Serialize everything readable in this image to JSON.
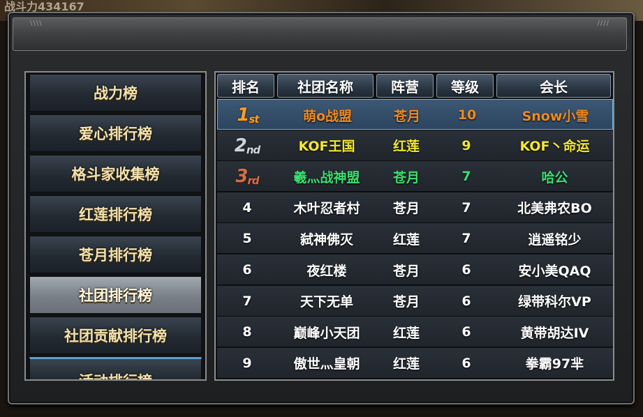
{
  "topbar": {
    "text": "战斗力434167"
  },
  "menu": {
    "items": [
      {
        "label": "战力榜"
      },
      {
        "label": "爱心排行榜"
      },
      {
        "label": "格斗家收集榜"
      },
      {
        "label": "红莲排行榜"
      },
      {
        "label": "苍月排行榜"
      },
      {
        "label": "社团排行榜",
        "selected": true
      },
      {
        "label": "社团贡献排行榜"
      },
      {
        "label": "活动排行榜"
      }
    ]
  },
  "table": {
    "headers": {
      "rank": "排名",
      "name": "社团名称",
      "faction": "阵营",
      "level": "等级",
      "leader": "会长"
    },
    "badges": {
      "first": {
        "num": "1",
        "suffix": "st"
      },
      "second": {
        "num": "2",
        "suffix": "nd"
      },
      "third": {
        "num": "3",
        "suffix": "rd"
      }
    },
    "rows": [
      {
        "rank": "1st",
        "name": "萌o战盟",
        "faction": "苍月",
        "level": "10",
        "leader": "Snow小雪",
        "color": "#f08a20"
      },
      {
        "rank": "2nd",
        "name": "KOF王国",
        "faction": "红莲",
        "level": "9",
        "leader": "KOF丶命运",
        "color": "#f2e832"
      },
      {
        "rank": "3rd",
        "name": "羲灬战神盟",
        "faction": "苍月",
        "level": "7",
        "leader": "哈公",
        "color": "#3ae070"
      },
      {
        "rank": "4",
        "name": "木叶忍者村",
        "faction": "苍月",
        "level": "7",
        "leader": "北美弗农BO",
        "color": "#ffffff"
      },
      {
        "rank": "5",
        "name": "弑神佛灭",
        "faction": "红莲",
        "level": "7",
        "leader": "逍遥铭少",
        "color": "#ffffff"
      },
      {
        "rank": "6",
        "name": "夜红楼",
        "faction": "苍月",
        "level": "6",
        "leader": "安小美QAQ",
        "color": "#ffffff"
      },
      {
        "rank": "7",
        "name": "天下无单",
        "faction": "苍月",
        "level": "6",
        "leader": "绿带科尔VP",
        "color": "#ffffff"
      },
      {
        "rank": "8",
        "name": "巅峰小天团",
        "faction": "红莲",
        "level": "6",
        "leader": "黄带胡达IV",
        "color": "#ffffff"
      },
      {
        "rank": "9",
        "name": "傲世灬皇朝",
        "faction": "红莲",
        "level": "6",
        "leader": "拳霸97芈",
        "color": "#ffffff"
      }
    ]
  }
}
